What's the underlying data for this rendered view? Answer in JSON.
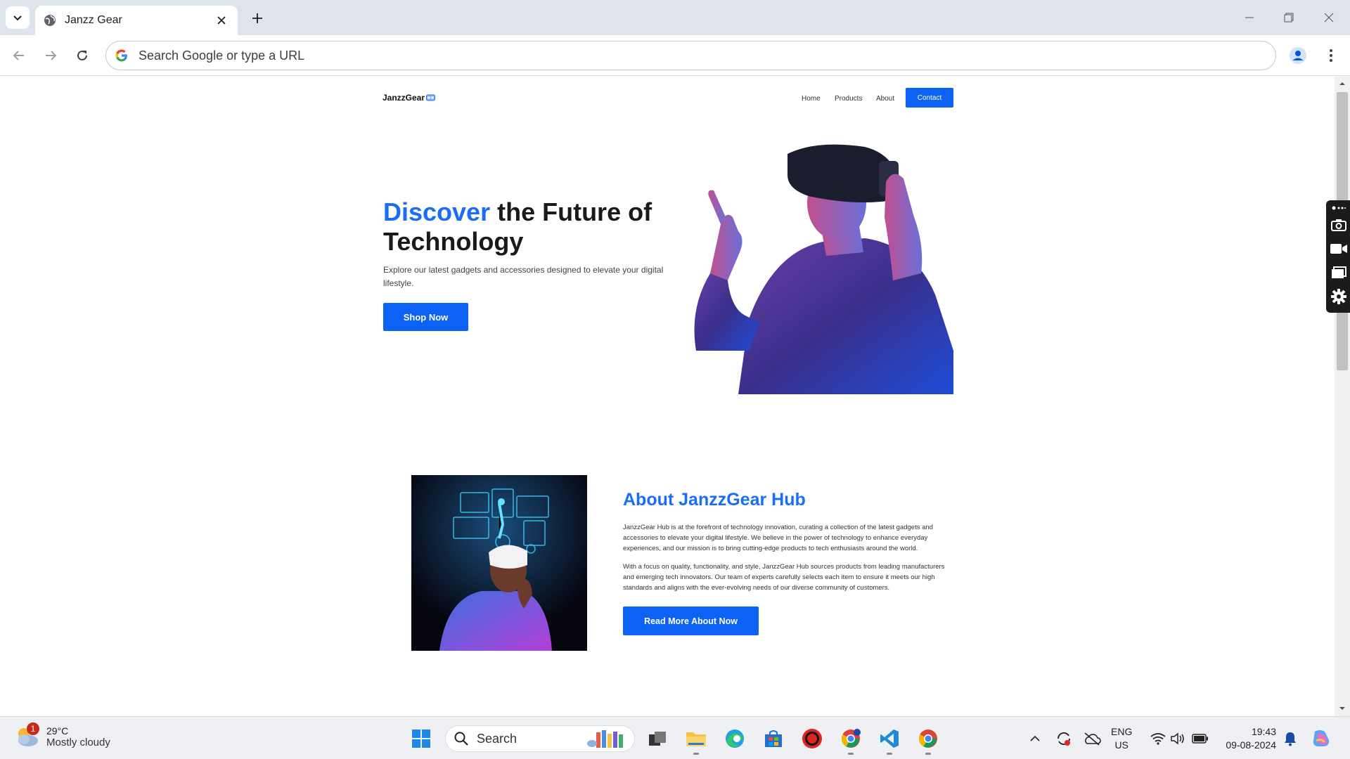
{
  "browser": {
    "tab_title": "Janzz Gear",
    "omnibox_placeholder": "Search Google or type a URL"
  },
  "site": {
    "brand": "JanzzGear",
    "nav": {
      "home": "Home",
      "products": "Products",
      "about": "About",
      "contact": "Contact"
    },
    "hero": {
      "title_accent": "Discover",
      "title_rest": " the Future of Technology",
      "subtitle": "Explore our latest gadgets and accessories designed to elevate your digital lifestyle.",
      "cta": "Shop Now"
    },
    "about": {
      "title": "About JanzzGear Hub",
      "p1": "JanzzGear Hub is at the forefront of technology innovation, curating a collection of the latest gadgets and accessories to elevate your digital lifestyle. We believe in the power of technology to enhance everyday experiences, and our mission is to bring cutting-edge products to tech enthusiasts around the world.",
      "p2": "With a focus on quality, functionality, and style, JanzzGear Hub sources products from leading manufacturers and emerging tech innovators. Our team of experts carefully selects each item to ensure it meets our high standards and aligns with the ever-evolving needs of our diverse community of customers.",
      "cta": "Read More About Now"
    }
  },
  "taskbar": {
    "weather_temp": "29°C",
    "weather_desc": "Mostly cloudy",
    "weather_badge": "1",
    "search_label": "Search",
    "lang_1": "ENG",
    "lang_2": "US",
    "time": "19:43",
    "date": "09-08-2024"
  },
  "colors": {
    "accent": "#1a6ef5",
    "button": "#0d62f5"
  }
}
